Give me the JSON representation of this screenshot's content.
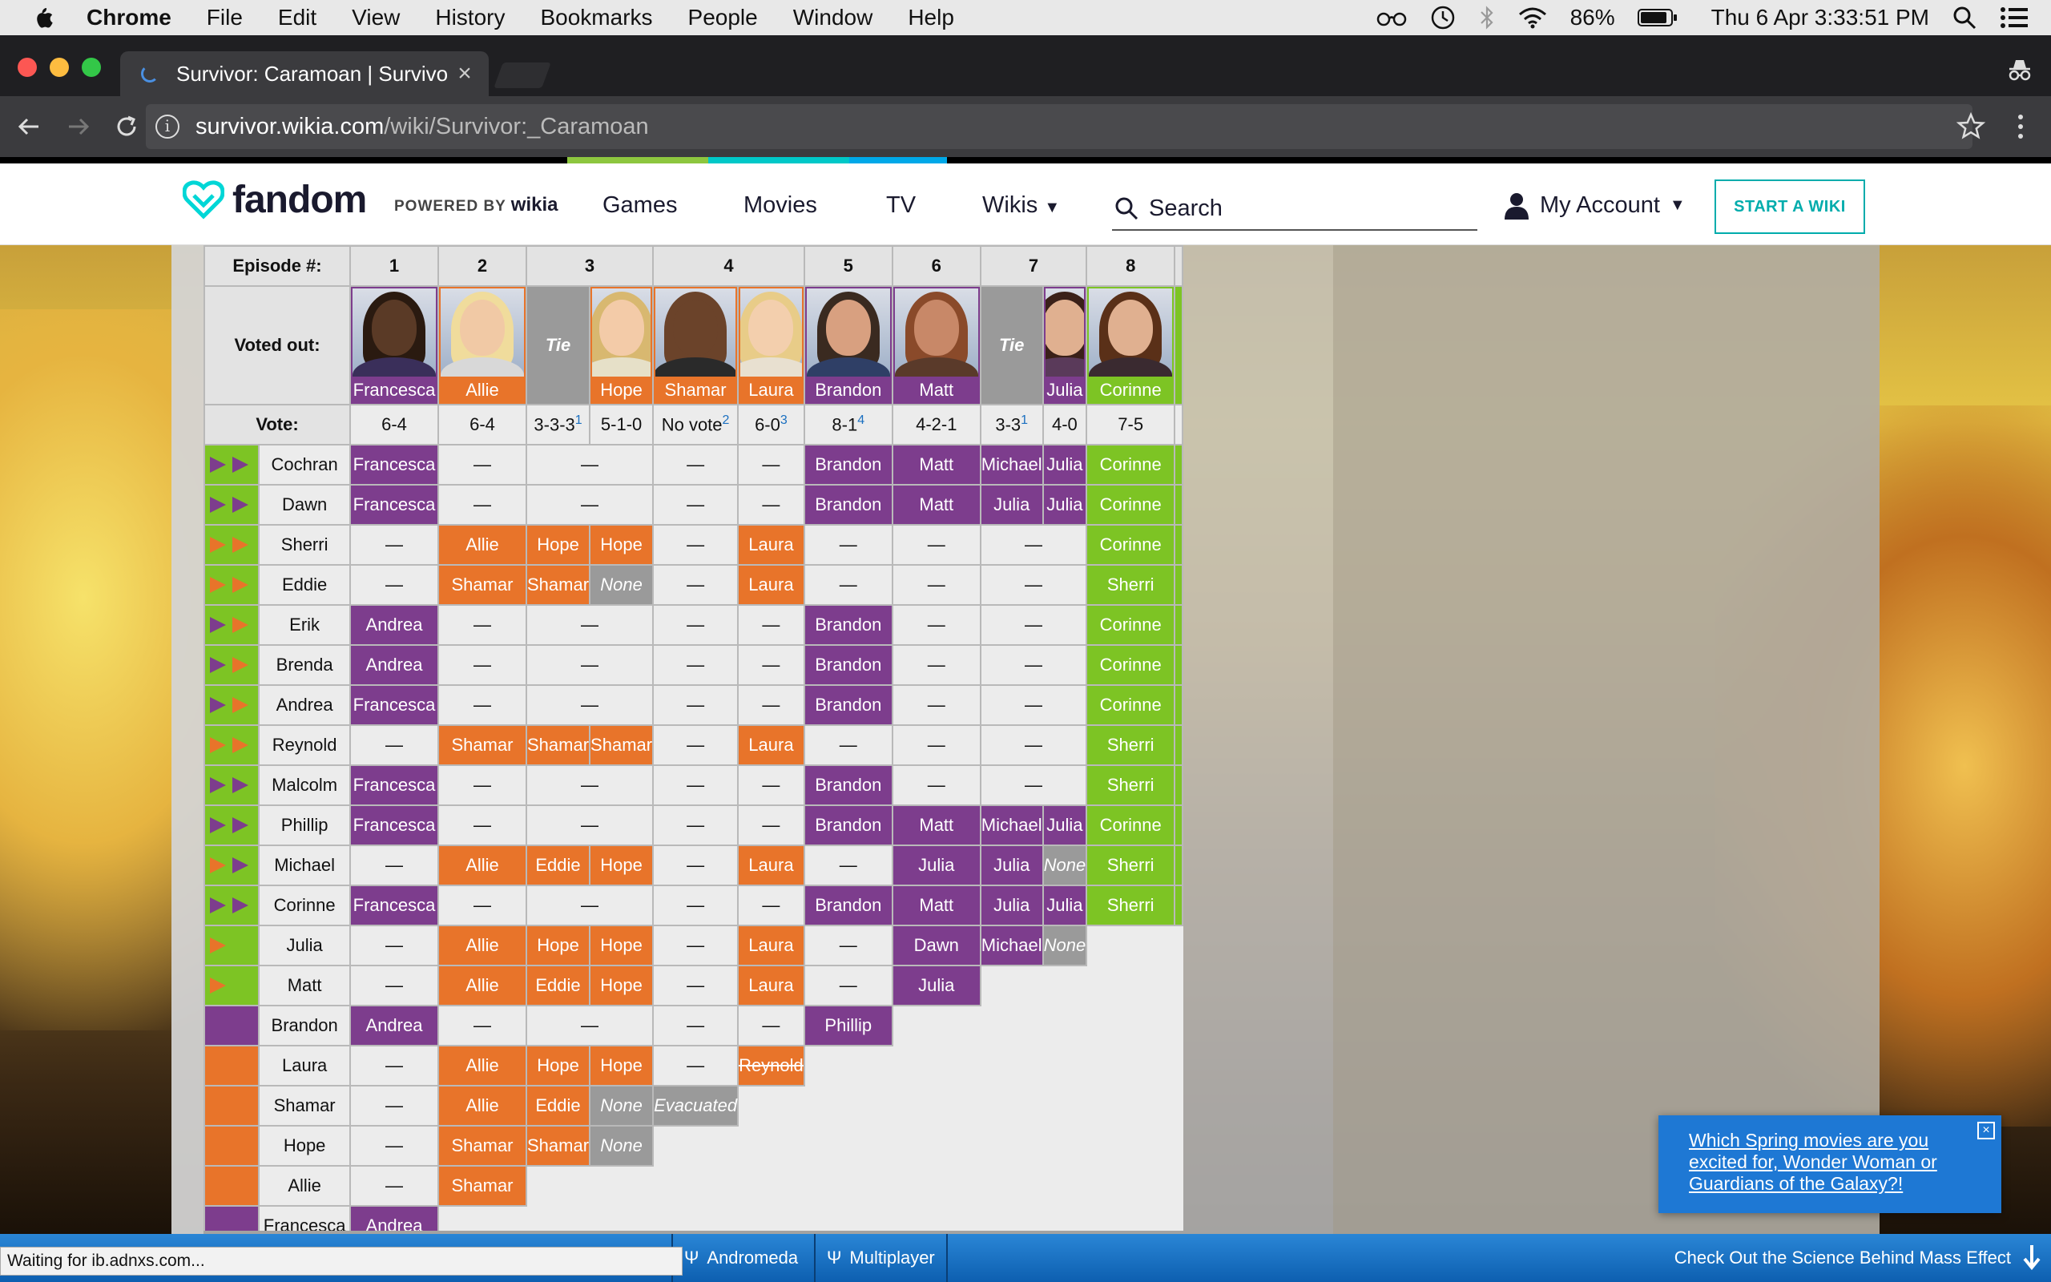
{
  "menubar": {
    "app": "Chrome",
    "items": [
      "File",
      "Edit",
      "View",
      "History",
      "Bookmarks",
      "People",
      "Window",
      "Help"
    ],
    "battery": "86%",
    "clock": "Thu 6 Apr  3:33:51 PM"
  },
  "browser": {
    "tab_title": "Survivor: Caramoan | Survivor",
    "url_host": "survivor.wikia.com",
    "url_path": "/wiki/Survivor:_Caramoan",
    "status_text": "Waiting for ib.adnxs.com..."
  },
  "fandom": {
    "logo_text": "fandom",
    "powered_by": "POWERED BY",
    "powered_wikia": "wikia",
    "nav": [
      "Games",
      "Movies",
      "TV",
      "Wikis"
    ],
    "search_placeholder": "Search",
    "account": "My Account",
    "start_wiki": "START A WIKI"
  },
  "colors": {
    "purple": "#7d3d8d",
    "orange": "#e8742a",
    "green": "#7dc424",
    "gray": "#9a9a9a"
  },
  "vote_table": {
    "episode_label": "Episode #:",
    "voted_out_label": "Voted out:",
    "vote_label": "Vote:",
    "tie_label": "Tie",
    "episodes": [
      "1",
      "2",
      "3",
      "4",
      "5",
      "6",
      "7",
      "8"
    ],
    "voted_out": [
      "Francesca",
      "Allie",
      "Tie",
      "Hope",
      "Shamar",
      "Laura",
      "Brandon",
      "Matt",
      "Tie",
      "Julia",
      "Corinne"
    ],
    "votes": [
      {
        "text": "6-4",
        "note": ""
      },
      {
        "text": "6-4",
        "note": ""
      },
      {
        "text": "3-3-3",
        "note": "1"
      },
      {
        "text": "5-1-0",
        "note": ""
      },
      {
        "text": "No vote",
        "note": "2"
      },
      {
        "text": "6-0",
        "note": "3"
      },
      {
        "text": "8-1",
        "note": "4"
      },
      {
        "text": "4-2-1",
        "note": ""
      },
      {
        "text": "3-3",
        "note": "1"
      },
      {
        "text": "4-0",
        "note": ""
      },
      {
        "text": "7-5",
        "note": ""
      }
    ],
    "rows": [
      {
        "name": "Cochran",
        "cells": [
          "Francesca",
          "—",
          "—",
          "—",
          "—",
          "Brandon",
          "Matt",
          "Michael",
          "Julia",
          "Corinne"
        ]
      },
      {
        "name": "Dawn",
        "cells": [
          "Francesca",
          "—",
          "—",
          "—",
          "—",
          "Brandon",
          "Matt",
          "Julia",
          "Julia",
          "Corinne"
        ]
      },
      {
        "name": "Sherri",
        "cells": [
          "—",
          "Allie",
          "Hope",
          "Hope",
          "—",
          "Laura",
          "—",
          "—",
          "—",
          "Corinne"
        ]
      },
      {
        "name": "Eddie",
        "cells": [
          "—",
          "Shamar",
          "Shamar",
          "None",
          "—",
          "Laura",
          "—",
          "—",
          "—",
          "Sherri"
        ]
      },
      {
        "name": "Erik",
        "cells": [
          "Andrea",
          "—",
          "—",
          "—",
          "—",
          "Brandon",
          "—",
          "—",
          "Corinne"
        ]
      },
      {
        "name": "Brenda",
        "cells": [
          "Andrea",
          "—",
          "—",
          "—",
          "—",
          "Brandon",
          "—",
          "—",
          "Corinne"
        ]
      },
      {
        "name": "Andrea",
        "cells": [
          "Francesca",
          "—",
          "—",
          "—",
          "—",
          "Brandon",
          "—",
          "—",
          "Corinne"
        ]
      },
      {
        "name": "Reynold",
        "cells": [
          "—",
          "Shamar",
          "Shamar",
          "Shamar",
          "—",
          "Laura",
          "—",
          "—",
          "—",
          "Sherri"
        ]
      },
      {
        "name": "Malcolm",
        "cells": [
          "Francesca",
          "—",
          "—",
          "—",
          "—",
          "Brandon",
          "—",
          "—",
          "Sherri"
        ]
      },
      {
        "name": "Phillip",
        "cells": [
          "Francesca",
          "—",
          "—",
          "—",
          "—",
          "Brandon",
          "Matt",
          "Michael",
          "Julia",
          "Corinne"
        ]
      },
      {
        "name": "Michael",
        "cells": [
          "—",
          "Allie",
          "Eddie",
          "Hope",
          "—",
          "Laura",
          "—",
          "Julia",
          "Julia",
          "None",
          "Sherri"
        ]
      },
      {
        "name": "Corinne",
        "cells": [
          "Francesca",
          "—",
          "—",
          "—",
          "—",
          "Brandon",
          "Matt",
          "Julia",
          "Julia",
          "Sherri"
        ]
      },
      {
        "name": "Julia",
        "cells": [
          "—",
          "Allie",
          "Hope",
          "Hope",
          "—",
          "Laura",
          "—",
          "Dawn",
          "Michael",
          "None"
        ]
      },
      {
        "name": "Matt",
        "cells": [
          "—",
          "Allie",
          "Eddie",
          "Hope",
          "—",
          "Laura",
          "—",
          "Julia"
        ]
      },
      {
        "name": "Brandon",
        "cells": [
          "Andrea",
          "—",
          "—",
          "—",
          "—",
          "Phillip"
        ]
      },
      {
        "name": "Laura",
        "cells": [
          "—",
          "Allie",
          "Hope",
          "Hope",
          "—",
          "Reynold"
        ]
      },
      {
        "name": "Shamar",
        "cells": [
          "—",
          "Allie",
          "Eddie",
          "None",
          "Evacuated"
        ]
      },
      {
        "name": "Hope",
        "cells": [
          "—",
          "Shamar",
          "Shamar",
          "None"
        ]
      },
      {
        "name": "Allie",
        "cells": [
          "—",
          "Shamar"
        ]
      },
      {
        "name": "Francesca",
        "cells": [
          "Andrea"
        ]
      }
    ]
  },
  "bottom_bar": {
    "items": [
      "Andromeda",
      "Multiplayer"
    ],
    "promo": "Check Out the Science Behind Mass Effect"
  },
  "poll": {
    "question": "Which Spring movies are you excited for, Wonder Woman or Guardians of the Galaxy?!"
  }
}
